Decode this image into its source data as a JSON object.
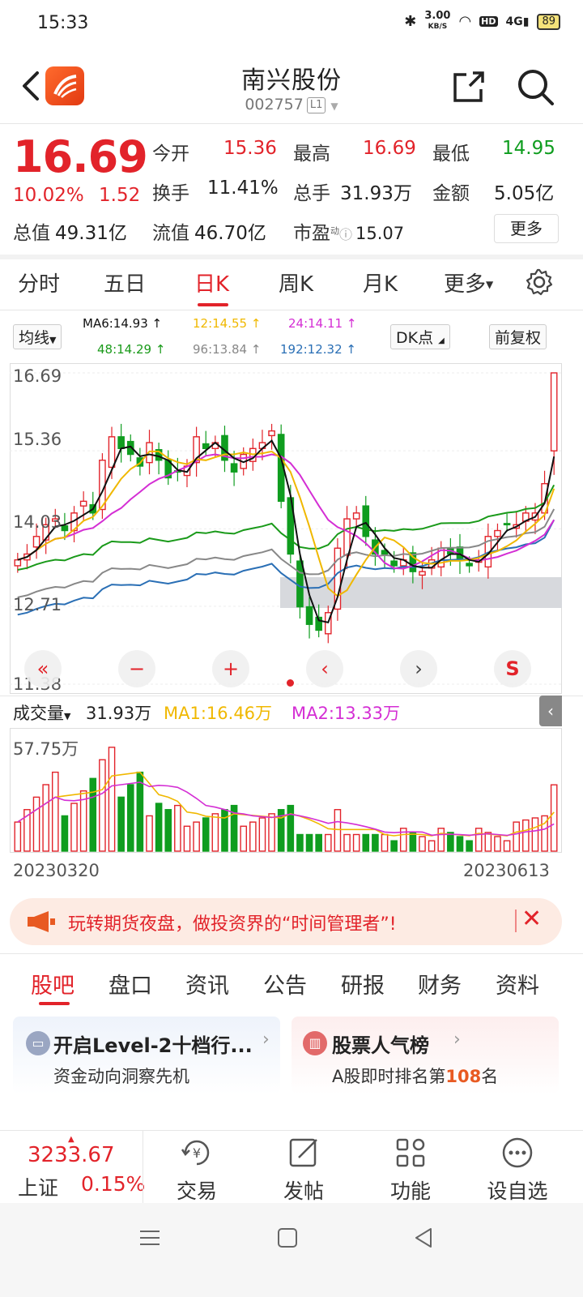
{
  "status": {
    "time": "15:33",
    "speed": "3.00",
    "speed_unit": "KB/S",
    "battery": "89"
  },
  "stock": {
    "name": "南兴股份",
    "code": "002757",
    "level": "L1"
  },
  "quote": {
    "price": "16.69",
    "pct": "10.02%",
    "change": "1.52",
    "open_label": "今开",
    "open": "15.36",
    "high_label": "最高",
    "high": "16.69",
    "low_label": "最低",
    "low": "14.95",
    "turnover_label": "换手",
    "turnover": "11.41%",
    "volume_label": "总手",
    "volume": "31.93万",
    "amount_label": "金额",
    "amount": "5.05亿",
    "mktcap_label": "总值",
    "mktcap": "49.31亿",
    "float_label": "流值",
    "float": "46.70亿",
    "pe_label": "市盈",
    "pe_sup": "动",
    "pe": "15.07",
    "more": "更多"
  },
  "ktabs": [
    "分时",
    "五日",
    "日K",
    "周K",
    "月K",
    "更多"
  ],
  "ktab_active": 2,
  "ma_bar": {
    "selector": "均线",
    "ma6": "MA6:14.93",
    "ma12": "12:14.55",
    "ma24": "24:14.11",
    "ma48": "48:14.29",
    "ma96": "96:13.84",
    "ma192": "192:12.32",
    "dk": "DK点",
    "fuquan": "前复权"
  },
  "colors": {
    "up": "#e2232a",
    "down": "#0f9d1f",
    "ma6": "#111111",
    "ma12": "#f0b800",
    "ma24": "#d42ed4",
    "ma48": "#1a9a1a",
    "ma96": "#888888",
    "ma192": "#2a6fb5"
  },
  "chart_data": [
    {
      "type": "candlestick",
      "y_ticks": [
        "16.69",
        "15.36",
        "14.03",
        "12.71",
        "11.38"
      ],
      "ylim": [
        11.38,
        16.69
      ],
      "x_start": "20230320",
      "x_end": "20230613",
      "last": {
        "open": 15.36,
        "high": 16.69,
        "low": 14.95,
        "close": 16.69
      }
    },
    {
      "type": "bar",
      "title": "成交量",
      "value": "31.93万",
      "ma1": "MA1:16.46万",
      "ma2": "MA2:13.33万",
      "ymax_label": "57.75万",
      "ymax": 57.75,
      "last_value": 31.93
    }
  ],
  "ad": {
    "text": "玩转期货夜盘，做投资界的“时间管理者”!"
  },
  "btabs": [
    "股吧",
    "盘口",
    "资讯",
    "公告",
    "研报",
    "财务",
    "资料"
  ],
  "cards": [
    {
      "title": "开启Level-2十档行...",
      "sub": "资金动向洞察先机"
    },
    {
      "title": "股票人气榜",
      "sub_pre": "A股即时排名第",
      "rank": "108",
      "sub_post": "名"
    }
  ],
  "index": {
    "value": "3233.67",
    "name": "上证",
    "pct": "0.15%"
  },
  "bnav": [
    "交易",
    "发帖",
    "功能",
    "设自选"
  ]
}
